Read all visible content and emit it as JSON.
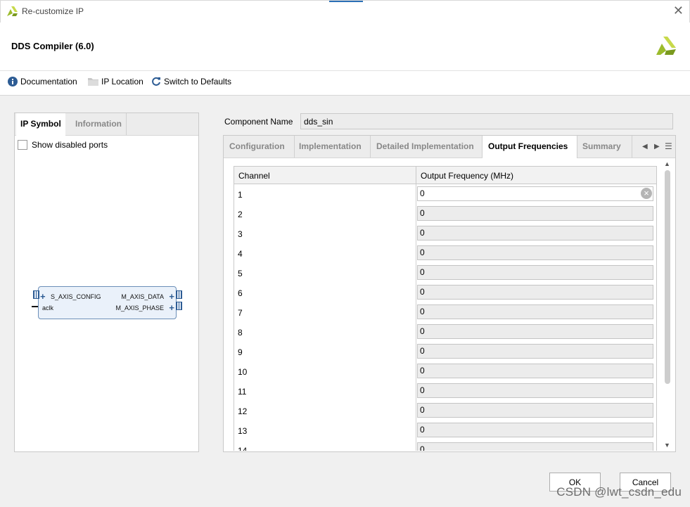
{
  "window": {
    "title": "Re-customize IP",
    "close_glyph": "✕"
  },
  "header": {
    "ip_title": "DDS Compiler (6.0)"
  },
  "toolbar": {
    "documentation": "Documentation",
    "ip_location": "IP Location",
    "switch_defaults": "Switch to Defaults"
  },
  "left_tabs": [
    "IP Symbol",
    "Information"
  ],
  "show_disabled_ports": "Show disabled ports",
  "ip_symbol": {
    "left_ports": [
      "S_AXIS_CONFIG",
      "aclk"
    ],
    "right_ports": [
      "M_AXIS_DATA",
      "M_AXIS_PHASE"
    ]
  },
  "component": {
    "label": "Component Name",
    "value": "dds_sin"
  },
  "right_tabs": [
    "Configuration",
    "Implementation",
    "Detailed Implementation",
    "Output Frequencies",
    "Summary"
  ],
  "table": {
    "headers": [
      "Channel",
      "Output Frequency (MHz)"
    ],
    "rows": [
      {
        "channel": "1",
        "value": "0"
      },
      {
        "channel": "2",
        "value": "0"
      },
      {
        "channel": "3",
        "value": "0"
      },
      {
        "channel": "4",
        "value": "0"
      },
      {
        "channel": "5",
        "value": "0"
      },
      {
        "channel": "6",
        "value": "0"
      },
      {
        "channel": "7",
        "value": "0"
      },
      {
        "channel": "8",
        "value": "0"
      },
      {
        "channel": "9",
        "value": "0"
      },
      {
        "channel": "10",
        "value": "0"
      },
      {
        "channel": "11",
        "value": "0"
      },
      {
        "channel": "12",
        "value": "0"
      },
      {
        "channel": "13",
        "value": "0"
      },
      {
        "channel": "14",
        "value": "0"
      }
    ]
  },
  "buttons": {
    "ok": "OK",
    "cancel": "Cancel"
  },
  "watermark": "CSDN @lwt_csdn_edu",
  "colors": {
    "xilinx_logo": "#9bbb2c",
    "accent": "#2b6fb6",
    "info_icon": "#2d5c94"
  }
}
